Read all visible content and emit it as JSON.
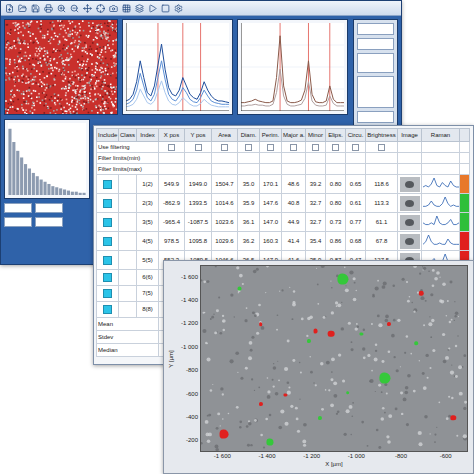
{
  "analysis_window": {
    "spectrum_charts": [
      {
        "y_max": 100,
        "markers": [
          9,
          16,
          21
        ],
        "series": [
          {
            "color": "#1f4e9c",
            "values": [
              12,
              14,
              20,
              35,
              60,
              40,
              22,
              18,
              30,
              55,
              80,
              50,
              28,
              20,
              18,
              25,
              40,
              30,
              20,
              16,
              14,
              22,
              35,
              25,
              18,
              14,
              12,
              12,
              11,
              10
            ]
          },
          {
            "color": "#5b8fd6",
            "values": [
              8,
              10,
              14,
              25,
              45,
              30,
              16,
              12,
              20,
              40,
              60,
              38,
              20,
              14,
              12,
              18,
              28,
              22,
              14,
              11,
              10,
              16,
              25,
              18,
              12,
              10,
              9,
              8,
              8,
              8
            ]
          },
          {
            "color": "#a9c7ee",
            "values": [
              5,
              6,
              8,
              14,
              26,
              18,
              10,
              8,
              12,
              24,
              36,
              22,
              12,
              8,
              7,
              10,
              16,
              12,
              8,
              6,
              6,
              9,
              14,
              10,
              7,
              6,
              5,
              5,
              5,
              5
            ]
          }
        ]
      },
      {
        "y_max": 100,
        "markers": [
          11,
          19,
          25
        ],
        "series": [
          {
            "color": "#8a5a4a",
            "values": [
              10,
              10,
              11,
              12,
              14,
              12,
              11,
              10,
              10,
              12,
              40,
              90,
              30,
              12,
              10,
              10,
              11,
              13,
              25,
              60,
              20,
              11,
              10,
              10,
              12,
              30,
              14,
              10,
              10,
              10
            ]
          },
          {
            "color": "#b0a0a0",
            "values": [
              6,
              6,
              7,
              7,
              8,
              7,
              7,
              6,
              6,
              8,
              22,
              50,
              18,
              8,
              6,
              6,
              7,
              8,
              15,
              35,
              12,
              7,
              6,
              6,
              7,
              18,
              9,
              6,
              6,
              6
            ]
          }
        ]
      }
    ],
    "histogram": {
      "values": [
        60,
        48,
        40,
        34,
        28,
        24,
        20,
        17,
        14,
        12,
        10,
        8,
        7,
        6,
        5,
        4,
        3,
        3,
        2,
        2
      ]
    }
  },
  "table": {
    "columns": [
      "Include",
      "Class",
      "Index",
      "X pos",
      "Y pos",
      "Area",
      "Diam.",
      "Perim.",
      "Major a.",
      "Minor",
      "Elips.",
      "Circu.",
      "Brightness",
      "Image",
      "Raman"
    ],
    "filter_rows": [
      {
        "label": "Use filtering",
        "kind": "checkboxes",
        "checked": false
      },
      {
        "label": "Filter limits(min)",
        "kind": "blank",
        "checked": false
      },
      {
        "label": "Filter limits(max)",
        "kind": "blank",
        "checked": false
      }
    ],
    "rows": [
      {
        "kind": "measured",
        "index": "1(2)",
        "include": true,
        "values": [
          "549.9",
          "1949.0",
          "1504.7",
          "35.0",
          "170.1",
          "48.6",
          "39.2",
          "0.80",
          "0.65",
          "118.6"
        ],
        "raman": [
          2,
          3,
          2,
          4,
          8,
          3,
          2,
          5,
          3,
          2,
          6,
          3,
          2,
          2
        ],
        "color": "#e8782a"
      },
      {
        "kind": "measured",
        "index": "2(3)",
        "include": true,
        "values": [
          "-862.9",
          "1393.5",
          "1014.6",
          "35.9",
          "147.6",
          "40.8",
          "32.7",
          "0.80",
          "0.61",
          "113.3"
        ],
        "raman": [
          2,
          2,
          3,
          6,
          3,
          2,
          2,
          4,
          9,
          4,
          2,
          3,
          2,
          2
        ],
        "color": "#2fbf3a"
      },
      {
        "kind": "measured",
        "index": "3(5)",
        "include": true,
        "values": [
          "-965.4",
          "-1087.5",
          "1023.6",
          "36.1",
          "147.0",
          "44.9",
          "32.7",
          "0.73",
          "0.77",
          "61.1"
        ],
        "raman": [
          3,
          2,
          2,
          3,
          2,
          7,
          3,
          2,
          2,
          3,
          5,
          2,
          2,
          3
        ],
        "color": "#2fbf3a"
      },
      {
        "kind": "measured",
        "index": "4(5)",
        "include": true,
        "values": [
          "978.5",
          "1095.8",
          "1029.6",
          "36.2",
          "160.3",
          "41.4",
          "35.4",
          "0.86",
          "0.68",
          "67.8"
        ],
        "raman": [
          2,
          4,
          9,
          4,
          2,
          2,
          3,
          2,
          2,
          6,
          3,
          2,
          2,
          2
        ],
        "color": "#e0201e"
      },
      {
        "kind": "measured",
        "index": "5(5)",
        "include": true,
        "values": [
          "552.3",
          "-1089.5",
          "1046.6",
          "36.5",
          "147.9",
          "41.6",
          "35.9",
          "0.87",
          "0.47",
          "127.5"
        ],
        "raman": [
          2,
          2,
          2,
          3,
          5,
          2,
          2,
          3,
          8,
          3,
          2,
          2,
          4,
          2
        ],
        "color": "#e0201e"
      },
      {
        "kind": "index_only",
        "index": "6(6)",
        "include": true
      },
      {
        "kind": "index_only",
        "index": "7(5)",
        "include": true
      },
      {
        "kind": "index_only",
        "index": "8(8)",
        "include": true
      }
    ],
    "summary_rows": [
      "Mean",
      "Stdev",
      "Median"
    ]
  },
  "particle_map": {
    "x_label": "X [µm]",
    "y_label": "Y [µm]",
    "x_ticks": [
      {
        "label": "-1 600",
        "value": -1600
      },
      {
        "label": "-1 400",
        "value": -1400
      },
      {
        "label": "-1 200",
        "value": -1200
      },
      {
        "label": "-1 000",
        "value": -1000
      },
      {
        "label": "-800",
        "value": -800
      },
      {
        "label": "-600",
        "value": -600
      }
    ],
    "y_ticks": [
      {
        "label": "-1 600",
        "value": -1600
      },
      {
        "label": "-1 400",
        "value": -1400
      },
      {
        "label": "-1 200",
        "value": -1200
      },
      {
        "label": "-1 000",
        "value": -1000
      },
      {
        "label": "-800",
        "value": -800
      },
      {
        "label": "-600",
        "value": -600
      },
      {
        "label": "-400",
        "value": -400
      },
      {
        "label": "-200",
        "value": -200
      }
    ],
    "particles": [
      {
        "x": -1059,
        "y": -1586,
        "diameter": 50,
        "color": "#35c83a"
      },
      {
        "x": -872,
        "y": -733,
        "diameter": 50,
        "color": "#35c83a"
      },
      {
        "x": -1526,
        "y": -1505,
        "diameter": 22,
        "color": "#35c83a"
      },
      {
        "x": -1597,
        "y": -246,
        "diameter": 40,
        "color": "#e0201e"
      },
      {
        "x": -1112,
        "y": -1115,
        "diameter": 30,
        "color": "#e0201e"
      },
      {
        "x": -1183,
        "y": -1140,
        "diameter": 22,
        "color": "#e0201e"
      },
      {
        "x": -1431,
        "y": -1196,
        "diameter": 16,
        "color": "#e0201e"
      },
      {
        "x": -1212,
        "y": -1050,
        "diameter": 18,
        "color": "#35c83a"
      },
      {
        "x": -1390,
        "y": -181,
        "diameter": 32,
        "color": "#35c83a"
      },
      {
        "x": -707,
        "y": -1465,
        "diameter": 20,
        "color": "#e0201e"
      },
      {
        "x": -728,
        "y": -1034,
        "diameter": 16,
        "color": "#35c83a"
      },
      {
        "x": -562,
        "y": -384,
        "diameter": 24,
        "color": "#e0201e"
      },
      {
        "x": -1162,
        "y": -384,
        "diameter": 18,
        "color": "#35c83a"
      },
      {
        "x": -1431,
        "y": -506,
        "diameter": 18,
        "color": "#e0201e"
      },
      {
        "x": -1038,
        "y": -603,
        "diameter": 16,
        "color": "#35c83a"
      },
      {
        "x": -1319,
        "y": -587,
        "diameter": 14,
        "color": "#e0201e"
      },
      {
        "x": -976,
        "y": -1115,
        "diameter": 14,
        "color": "#35c83a"
      },
      {
        "x": -852,
        "y": -1196,
        "diameter": 18,
        "color": "#e0201e"
      }
    ]
  }
}
